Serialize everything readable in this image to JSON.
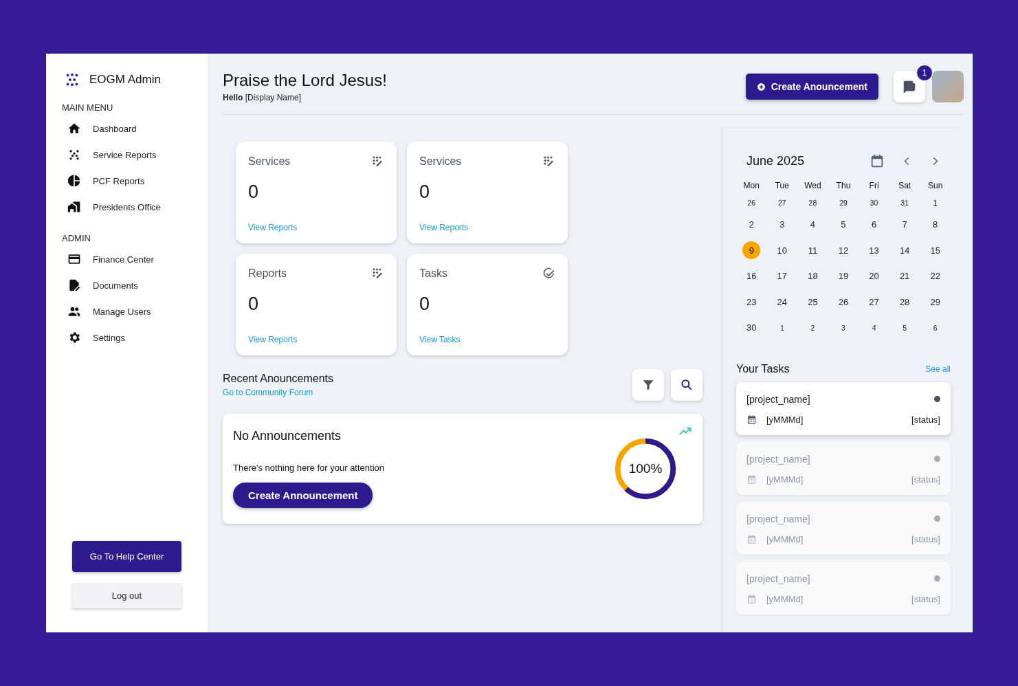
{
  "brand": {
    "name": "EOGM Admin"
  },
  "sidebar": {
    "sections": [
      {
        "title": "MAIN MENU",
        "items": [
          {
            "label": "Dashboard",
            "kind": "home"
          },
          {
            "label": "Service Reports",
            "kind": "dots"
          },
          {
            "label": "PCF Reports",
            "kind": "pie"
          },
          {
            "label": "Presidents Office",
            "kind": "building"
          }
        ]
      },
      {
        "title": "ADMIN",
        "items": [
          {
            "label": "Finance Center",
            "kind": "card"
          },
          {
            "label": "Documents",
            "kind": "doc"
          },
          {
            "label": "Manage Users",
            "kind": "users"
          },
          {
            "label": "Settings",
            "kind": "gear"
          }
        ]
      }
    ],
    "help_button": "Go To Help Center",
    "logout_button": "Log out"
  },
  "header": {
    "title": "Praise the Lord Jesus!",
    "greeting": "**Hello** [Display Name]",
    "create_button": "Create Anouncement",
    "notification_badge": "1"
  },
  "stat_cards": [
    {
      "title": "Services",
      "value": "0",
      "link": "View Reports",
      "kind": "report"
    },
    {
      "title": "Services",
      "value": "0",
      "link": "View Reports",
      "kind": "report"
    },
    {
      "title": "Reports",
      "value": "0",
      "link": "View Reports",
      "kind": "report"
    },
    {
      "title": "Tasks",
      "value": "0",
      "link": "View Tasks",
      "kind": "task"
    }
  ],
  "announcements": {
    "title": "Recent Anouncements",
    "link": "Go to Community Forum",
    "card_title": "No Announcements",
    "message": "There's nothing here for your attention",
    "button": "Create Announcement",
    "progress": {
      "reading": "100%"
    }
  },
  "calendar": {
    "month": "June 2025",
    "weekdays": [
      "Mon",
      "Tue",
      "Wed",
      "Thu",
      "Fri",
      "Sat",
      "Sun"
    ],
    "weeks": [
      [
        {
          "day": "26",
          "outside": true,
          "selected": false
        },
        {
          "day": "27",
          "outside": true,
          "selected": false
        },
        {
          "day": "28",
          "outside": true,
          "selected": false
        },
        {
          "day": "29",
          "outside": true,
          "selected": false
        },
        {
          "day": "30",
          "outside": true,
          "selected": false
        },
        {
          "day": "31",
          "outside": true,
          "selected": false
        },
        {
          "day": "1",
          "outside": false,
          "selected": false
        }
      ],
      [
        {
          "day": "2",
          "outside": false,
          "selected": false
        },
        {
          "day": "3",
          "outside": false,
          "selected": false
        },
        {
          "day": "4",
          "outside": false,
          "selected": false
        },
        {
          "day": "5",
          "outside": false,
          "selected": false
        },
        {
          "day": "6",
          "outside": false,
          "selected": false
        },
        {
          "day": "7",
          "outside": false,
          "selected": false
        },
        {
          "day": "8",
          "outside": false,
          "selected": false
        }
      ],
      [
        {
          "day": "9",
          "outside": false,
          "selected": true
        },
        {
          "day": "10",
          "outside": false,
          "selected": false
        },
        {
          "day": "11",
          "outside": false,
          "selected": false
        },
        {
          "day": "12",
          "outside": false,
          "selected": false
        },
        {
          "day": "13",
          "outside": false,
          "selected": false
        },
        {
          "day": "14",
          "outside": false,
          "selected": false
        },
        {
          "day": "15",
          "outside": false,
          "selected": false
        }
      ],
      [
        {
          "day": "16",
          "outside": false,
          "selected": false
        },
        {
          "day": "17",
          "outside": false,
          "selected": false
        },
        {
          "day": "18",
          "outside": false,
          "selected": false
        },
        {
          "day": "19",
          "outside": false,
          "selected": false
        },
        {
          "day": "20",
          "outside": false,
          "selected": false
        },
        {
          "day": "21",
          "outside": false,
          "selected": false
        },
        {
          "day": "22",
          "outside": false,
          "selected": false
        }
      ],
      [
        {
          "day": "23",
          "outside": false,
          "selected": false
        },
        {
          "day": "24",
          "outside": false,
          "selected": false
        },
        {
          "day": "25",
          "outside": false,
          "selected": false
        },
        {
          "day": "26",
          "outside": false,
          "selected": false
        },
        {
          "day": "27",
          "outside": false,
          "selected": false
        },
        {
          "day": "28",
          "outside": false,
          "selected": false
        },
        {
          "day": "29",
          "outside": false,
          "selected": false
        }
      ],
      [
        {
          "day": "30",
          "outside": false,
          "selected": false
        },
        {
          "day": "1",
          "outside": true,
          "selected": false
        },
        {
          "day": "2",
          "outside": true,
          "selected": false
        },
        {
          "day": "3",
          "outside": true,
          "selected": false
        },
        {
          "day": "4",
          "outside": true,
          "selected": false
        },
        {
          "day": "5",
          "outside": true,
          "selected": false
        },
        {
          "day": "6",
          "outside": true,
          "selected": false
        }
      ]
    ]
  },
  "tasks": {
    "title": "Your Tasks",
    "see_all": "See all",
    "items": [
      {
        "name": "[project_name]",
        "date": "[yMMMd]",
        "status": "[status]",
        "selected": true
      },
      {
        "name": "[project_name]",
        "date": "[yMMMd]",
        "status": "[status]",
        "selected": false
      },
      {
        "name": "[project_name]",
        "date": "[yMMMd]",
        "status": "[status]",
        "selected": false
      },
      {
        "name": "[project_name]",
        "date": "[yMMMd]",
        "status": "[status]",
        "selected": false
      }
    ]
  }
}
